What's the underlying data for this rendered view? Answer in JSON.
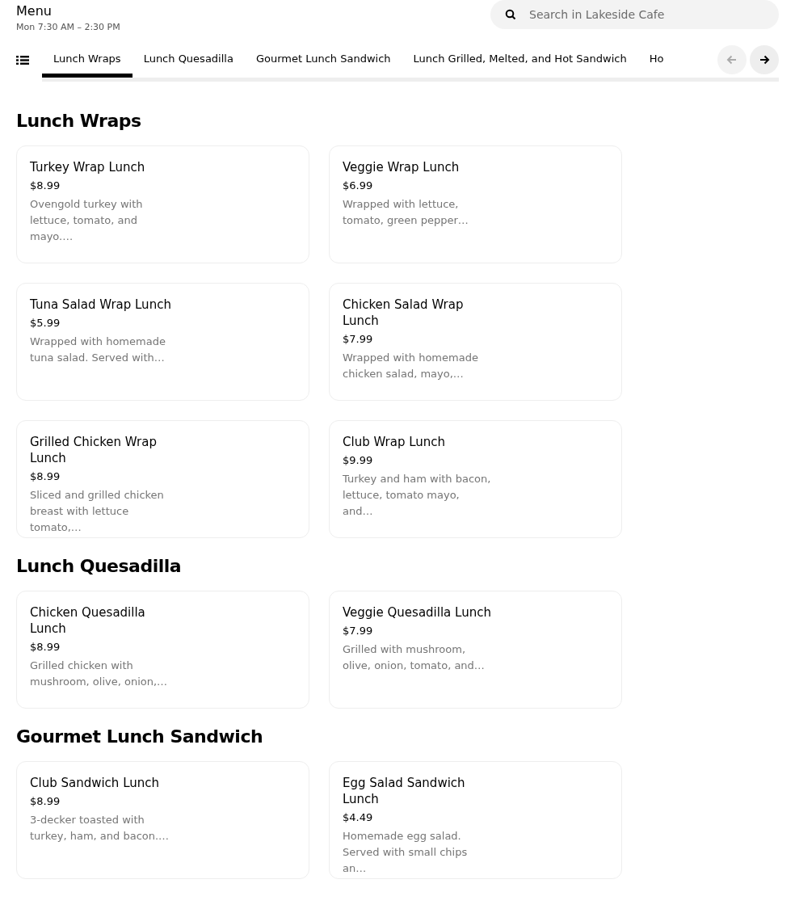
{
  "header": {
    "title": "Menu",
    "hours": "Mon 7:30 AM – 2:30 PM"
  },
  "search": {
    "placeholder": "Search in Lakeside Cafe"
  },
  "tabs": [
    {
      "label": "Lunch Wraps",
      "selected": true
    },
    {
      "label": "Lunch Quesadilla",
      "selected": false
    },
    {
      "label": "Gourmet Lunch Sandwich",
      "selected": false
    },
    {
      "label": "Lunch Grilled, Melted, and Hot Sandwich",
      "selected": false
    },
    {
      "label": "Ho",
      "selected": false
    }
  ],
  "scroll_buttons": [
    {
      "kind": "prev",
      "disabled": true
    },
    {
      "kind": "next",
      "disabled": false
    }
  ],
  "sections": [
    {
      "title": "Lunch Wraps",
      "items": [
        {
          "name": "Turkey Wrap Lunch",
          "price": "$8.99",
          "description": "Ovengold turkey with lettuce, tomato, and mayo.…"
        },
        {
          "name": "Veggie Wrap Lunch",
          "price": "$6.99",
          "description": "Wrapped with lettuce, tomato, green pepper…"
        },
        {
          "name": "Tuna Salad Wrap Lunch",
          "price": "$5.99",
          "description": "Wrapped with homemade tuna salad. Served with…"
        },
        {
          "name": "Chicken Salad Wrap Lunch",
          "price": "$7.99",
          "description": "Wrapped with homemade chicken salad, mayo,…"
        },
        {
          "name": "Grilled Chicken Wrap Lunch",
          "price": "$8.99",
          "description": "Sliced and grilled chicken breast with lettuce tomato,…"
        },
        {
          "name": "Club Wrap Lunch",
          "price": "$9.99",
          "description": "Turkey and ham with bacon, lettuce, tomato mayo, and…"
        }
      ]
    },
    {
      "title": "Lunch Quesadilla",
      "items": [
        {
          "name": "Chicken Quesadilla Lunch",
          "price": "$8.99",
          "description": "Grilled chicken with mushroom, olive, onion,…"
        },
        {
          "name": "Veggie Quesadilla Lunch",
          "price": "$7.99",
          "description": "Grilled with mushroom, olive, onion, tomato, and…"
        }
      ]
    },
    {
      "title": "Gourmet Lunch Sandwich",
      "items": [
        {
          "name": "Club Sandwich Lunch",
          "price": "$8.99",
          "description": "3-decker toasted with turkey, ham, and bacon.…"
        },
        {
          "name": "Egg Salad Sandwich Lunch",
          "price": "$4.49",
          "description": "Homemade egg salad. Served with small chips an…"
        }
      ]
    }
  ]
}
